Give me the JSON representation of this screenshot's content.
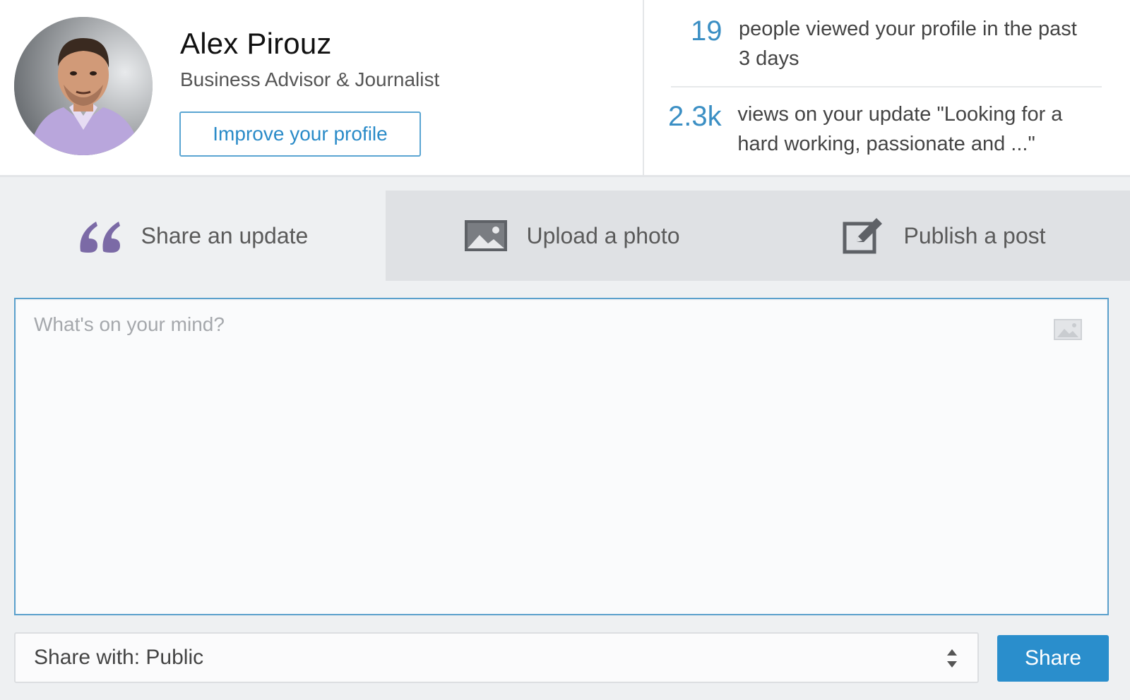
{
  "profile": {
    "name": "Alex Pirouz",
    "headline": "Business Advisor & Journalist",
    "improve_button": "Improve your profile"
  },
  "stats": [
    {
      "number": "19",
      "text": "people viewed your profile in the past 3 days"
    },
    {
      "number": "2.3k",
      "text": "views on your update \"Looking for a hard working, passionate and ...\""
    }
  ],
  "tabs": [
    {
      "label": "Share an update",
      "icon": "quote-icon",
      "active": true
    },
    {
      "label": "Upload a photo",
      "icon": "photo-icon",
      "active": false
    },
    {
      "label": "Publish a post",
      "icon": "edit-icon",
      "active": false
    }
  ],
  "composer": {
    "placeholder": "What's on your mind?",
    "attach_icon": "image-attach-icon"
  },
  "share_with": {
    "value": "Share with: Public"
  },
  "share_button": "Share",
  "colors": {
    "accent": "#2a8ecc",
    "stat_number": "#3b8fc4",
    "quote_icon": "#7b6aa6"
  }
}
